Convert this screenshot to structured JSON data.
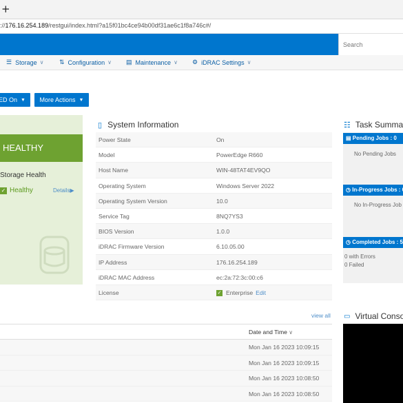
{
  "browser": {
    "new_tab_glyph": "+",
    "url_prefix": "://",
    "url_host": "176.16.254.189",
    "url_path": "/restgui/index.html?a15f01bc4ce94b00df31ae6c1f8a746c#/"
  },
  "header": {
    "search_placeholder": "Search"
  },
  "nav": {
    "items": [
      {
        "label": "Storage",
        "icon": "storage-icon"
      },
      {
        "label": "Configuration",
        "icon": "configuration-icon"
      },
      {
        "label": "Maintenance",
        "icon": "maintenance-icon"
      },
      {
        "label": "iDRAC Settings",
        "icon": "idrac-settings-icon"
      }
    ]
  },
  "actions": {
    "led_label": "LED On",
    "more_actions_label": "More Actions"
  },
  "health": {
    "status": "HEALTHY",
    "storage_title": "Storage Health",
    "storage_status": "Healthy",
    "details_label": "Details"
  },
  "system_info": {
    "title": "System Information",
    "rows": [
      {
        "key": "Power State",
        "value": "On"
      },
      {
        "key": "Model",
        "value": "PowerEdge R660"
      },
      {
        "key": "Host Name",
        "value": "WIN-48TAT4EV9QO"
      },
      {
        "key": "Operating System",
        "value": "Windows Server 2022"
      },
      {
        "key": "Operating System Version",
        "value": "10.0"
      },
      {
        "key": "Service Tag",
        "value": "8NQ7YS3"
      },
      {
        "key": "BIOS Version",
        "value": "1.0.0"
      },
      {
        "key": "iDRAC Firmware Version",
        "value": "6.10.05.00"
      },
      {
        "key": "IP Address",
        "value": "176.16.254.189"
      },
      {
        "key": "iDRAC MAC Address",
        "value": "ec:2a:72:3c:00:c6"
      }
    ],
    "license_key": "License",
    "license_value": "Enterprise",
    "license_edit": "Edit"
  },
  "task_summary": {
    "title": "Task Summar",
    "pending_head": "Pending Jobs : 0",
    "pending_text": "No Pending Jobs",
    "inprogress_head": "In-Progress Jobs : 0",
    "inprogress_text": "No In-Progress Job",
    "completed_head": "Completed Jobs : 5",
    "completed_errors": "0 with Errors",
    "completed_failed": "0 Failed"
  },
  "logs": {
    "view_all": "view all",
    "date_header": "Date and Time",
    "rows": [
      "Mon Jan 16 2023 10:09:15",
      "Mon Jan 16 2023 10:09:15",
      "Mon Jan 16 2023 10:08:50",
      "Mon Jan 16 2023 10:08:50"
    ]
  },
  "virtual_console": {
    "title": "Virtual Console"
  },
  "colors": {
    "brand_blue": "#0076ce",
    "healthy_green": "#6ea231",
    "health_panel_bg": "#e6f0d9",
    "link_blue": "#4d8dc8"
  }
}
